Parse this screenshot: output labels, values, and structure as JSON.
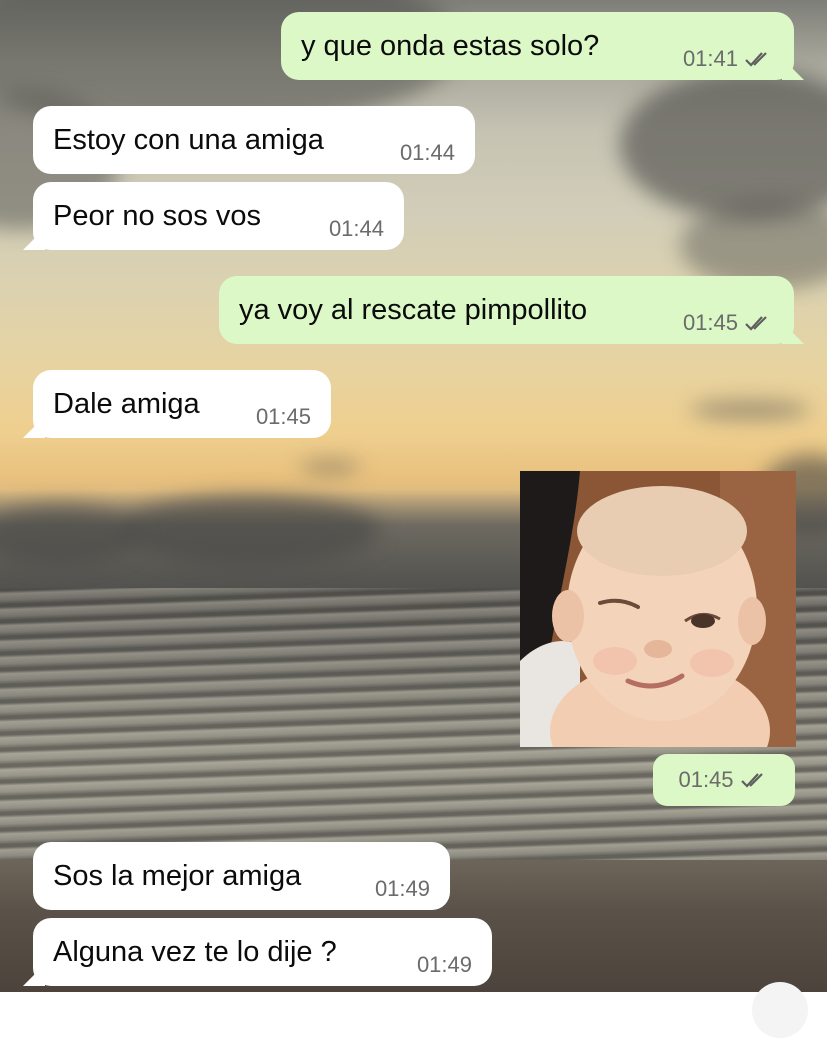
{
  "messages": [
    {
      "direction": "outgoing",
      "text": "y que onda estas solo?",
      "time": "01:41",
      "status_icon": "double-check-icon"
    },
    {
      "direction": "incoming",
      "text": "Estoy con una amiga",
      "time": "01:44"
    },
    {
      "direction": "incoming",
      "text": "Peor no sos vos",
      "time": "01:44"
    },
    {
      "direction": "outgoing",
      "text": "ya voy al rescate pimpollito",
      "time": "01:45",
      "status_icon": "double-check-icon"
    },
    {
      "direction": "incoming",
      "text": "Dale amiga",
      "time": "01:45"
    },
    {
      "direction": "outgoing",
      "type": "image",
      "image_description": "baby winking photo",
      "time": "01:45",
      "status_icon": "double-check-icon"
    },
    {
      "direction": "incoming",
      "text": "Sos la mejor amiga",
      "time": "01:49"
    },
    {
      "direction": "incoming",
      "text": "Alguna vez te lo dije ?",
      "time": "01:49"
    }
  ],
  "colors": {
    "outgoing_bubble": "#dcf8c6",
    "incoming_bubble": "#ffffff",
    "timestamp": "#6b6b6b",
    "text": "#0b0b0b"
  },
  "wallpaper": "beach-sunset"
}
